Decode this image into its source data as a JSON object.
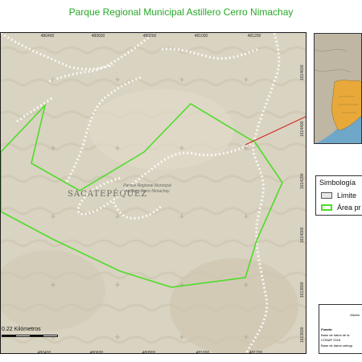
{
  "title": "Parque Regional Municipal Astillero Cerro Nimachay",
  "coords": {
    "top": [
      "480400",
      "480600",
      "480800",
      "481000",
      "481200"
    ],
    "bottom": [
      "480400",
      "480600",
      "480800",
      "481000",
      "481200"
    ],
    "right": [
      "1614600",
      "1614400",
      "1614200",
      "1614000",
      "1613800",
      "1613600"
    ]
  },
  "map_labels": {
    "town": "SACATEPÉQUEZ",
    "park": "Parque Regional Municipal Astillero Cerro Nimachay"
  },
  "legend": {
    "title": "Simbología",
    "items": [
      {
        "label": "Limite",
        "symbol": "limit"
      },
      {
        "label": "Área pr",
        "symbol": "area"
      }
    ]
  },
  "scale": {
    "label": "0.22 Kilómetros"
  },
  "info": {
    "header": "Sistem",
    "lines": [
      {
        "text": "Fuente:",
        "style": "bold"
      },
      {
        "text": "Base de datos de la",
        "style": "normal"
      },
      {
        "text": "CONAP 2016",
        "style": "normal"
      },
      {
        "text": "Base de datos cartogr",
        "style": "normal"
      }
    ]
  },
  "colors": {
    "title": "#27a827",
    "protected_area": "#4fdc2a",
    "basemap": "#d9d3c1",
    "road_line": "#ffffff",
    "inset_highlight": "#e8a93a",
    "leader_line": "#d32323"
  }
}
